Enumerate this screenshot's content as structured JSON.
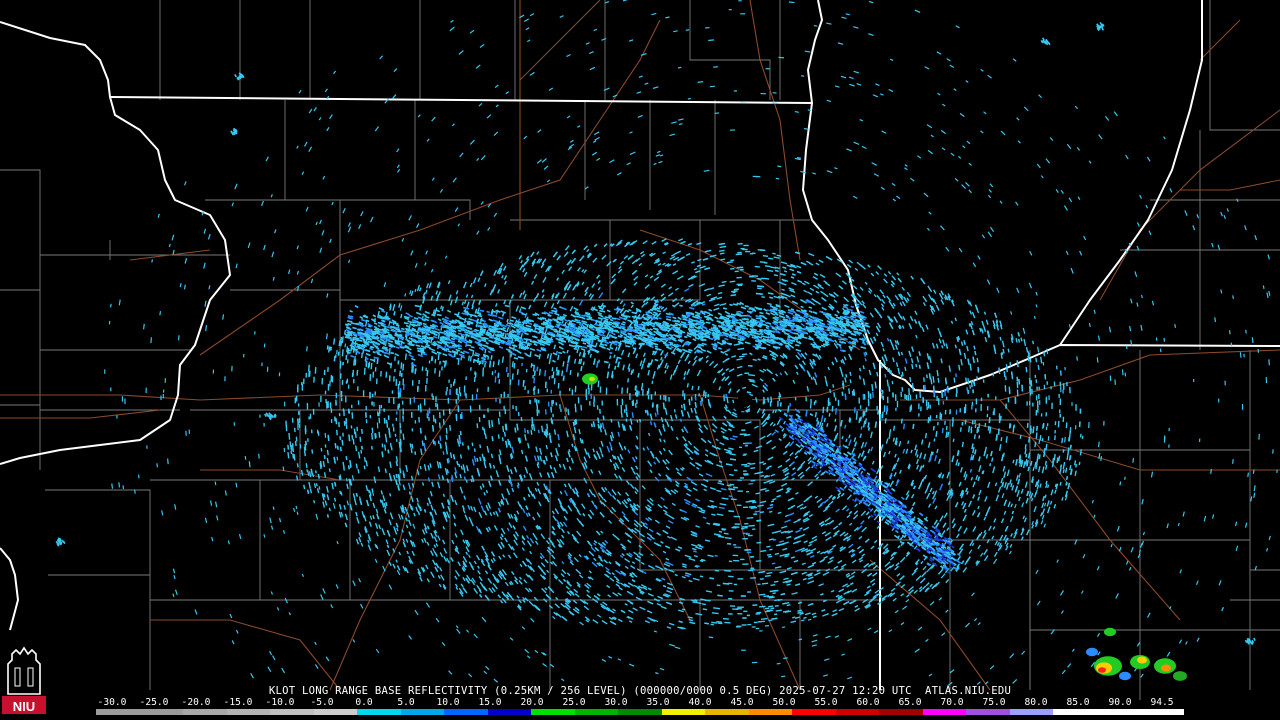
{
  "product_caption": "KLOT LONG RANGE BASE REFLECTIVITY (0.25KM / 256 LEVEL) (000000/0000 0.5 DEG) 2025-07-27 12:20 UTC  ATLAS.NIU.EDU",
  "logo_text": "NIU",
  "colorbar": {
    "labels": [
      "-30.0",
      "-25.0",
      "-20.0",
      "-15.0",
      "-10.0",
      "-5.0",
      "0.0",
      "5.0",
      "10.0",
      "15.0",
      "20.0",
      "25.0",
      "30.0",
      "35.0",
      "40.0",
      "45.0",
      "50.0",
      "55.0",
      "60.0",
      "65.0",
      "70.0",
      "75.0",
      "80.0",
      "85.0",
      "90.0",
      "94.5"
    ],
    "colors": [
      "#9c9c9c",
      "#9c9c9c",
      "#a8a8a8",
      "#b4b4b4",
      "#c0c0c0",
      "#cccccc",
      "#00d8f0",
      "#00a8e8",
      "#0066ff",
      "#0000c8",
      "#00e000",
      "#00b400",
      "#008c00",
      "#f0f000",
      "#e8b400",
      "#ff8c00",
      "#ff0000",
      "#d00000",
      "#a00000",
      "#ff00ff",
      "#a050e0",
      "#9aa0ff",
      "#ffffff",
      "#ffffff",
      "#ffffff"
    ]
  },
  "colors": {
    "background": "#000000",
    "state_border": "#ffffff",
    "county_border": "#7a7a7a",
    "highway": "#8b4a2a",
    "echo_light": "#36c8f0",
    "echo_mid": "#2a8cff",
    "echo_dark": "#1c3cd8",
    "echo_green": "#22cc22"
  }
}
